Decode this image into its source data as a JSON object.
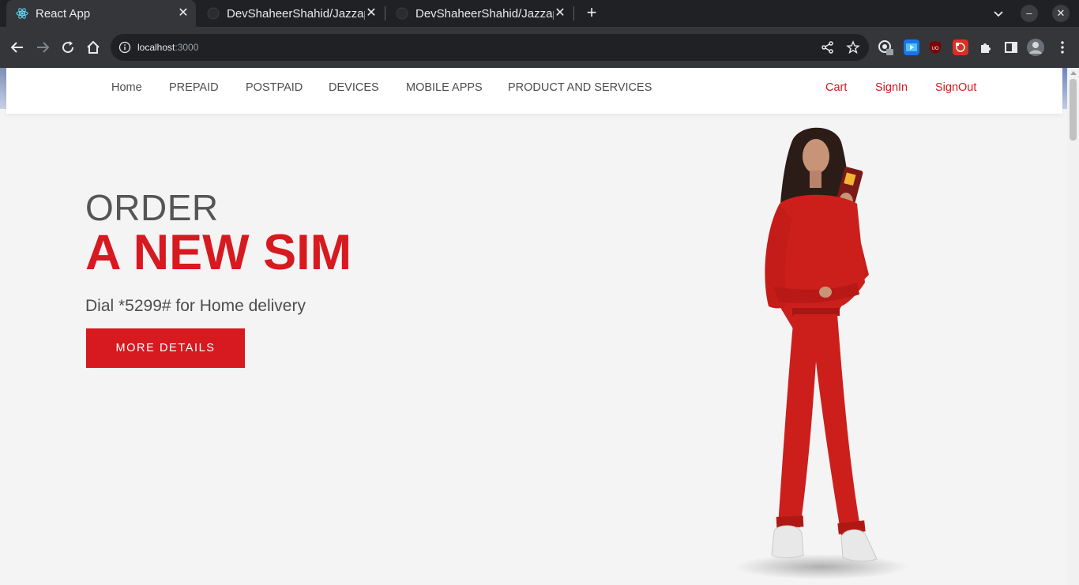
{
  "browser": {
    "tabs": [
      {
        "title": "React  App",
        "active": true,
        "favicon": "react-icon"
      },
      {
        "title": "DevShaheerShahid/Jazzap",
        "active": false,
        "favicon": "github-icon"
      },
      {
        "title": "DevShaheerShahid/Jazzap",
        "active": false,
        "favicon": "github-icon"
      }
    ],
    "url_host": "localhost",
    "url_port": ":3000"
  },
  "nav": {
    "left_links": [
      "Home",
      "PREPAID",
      "POSTPAID",
      "DEVICES",
      "MOBILE APPS",
      "PRODUCT AND SERVICES"
    ],
    "right_links": [
      "Cart",
      "SignIn",
      "SignOut"
    ]
  },
  "hero": {
    "line1": "ORDER",
    "line2": "A NEW SIM",
    "subtitle": "Dial *5299# for Home delivery",
    "button_label": "MORE DETAILS"
  },
  "colors": {
    "brand_red": "#d71920",
    "page_bg": "#f4f4f4",
    "text_gray": "#4d4d4d"
  }
}
